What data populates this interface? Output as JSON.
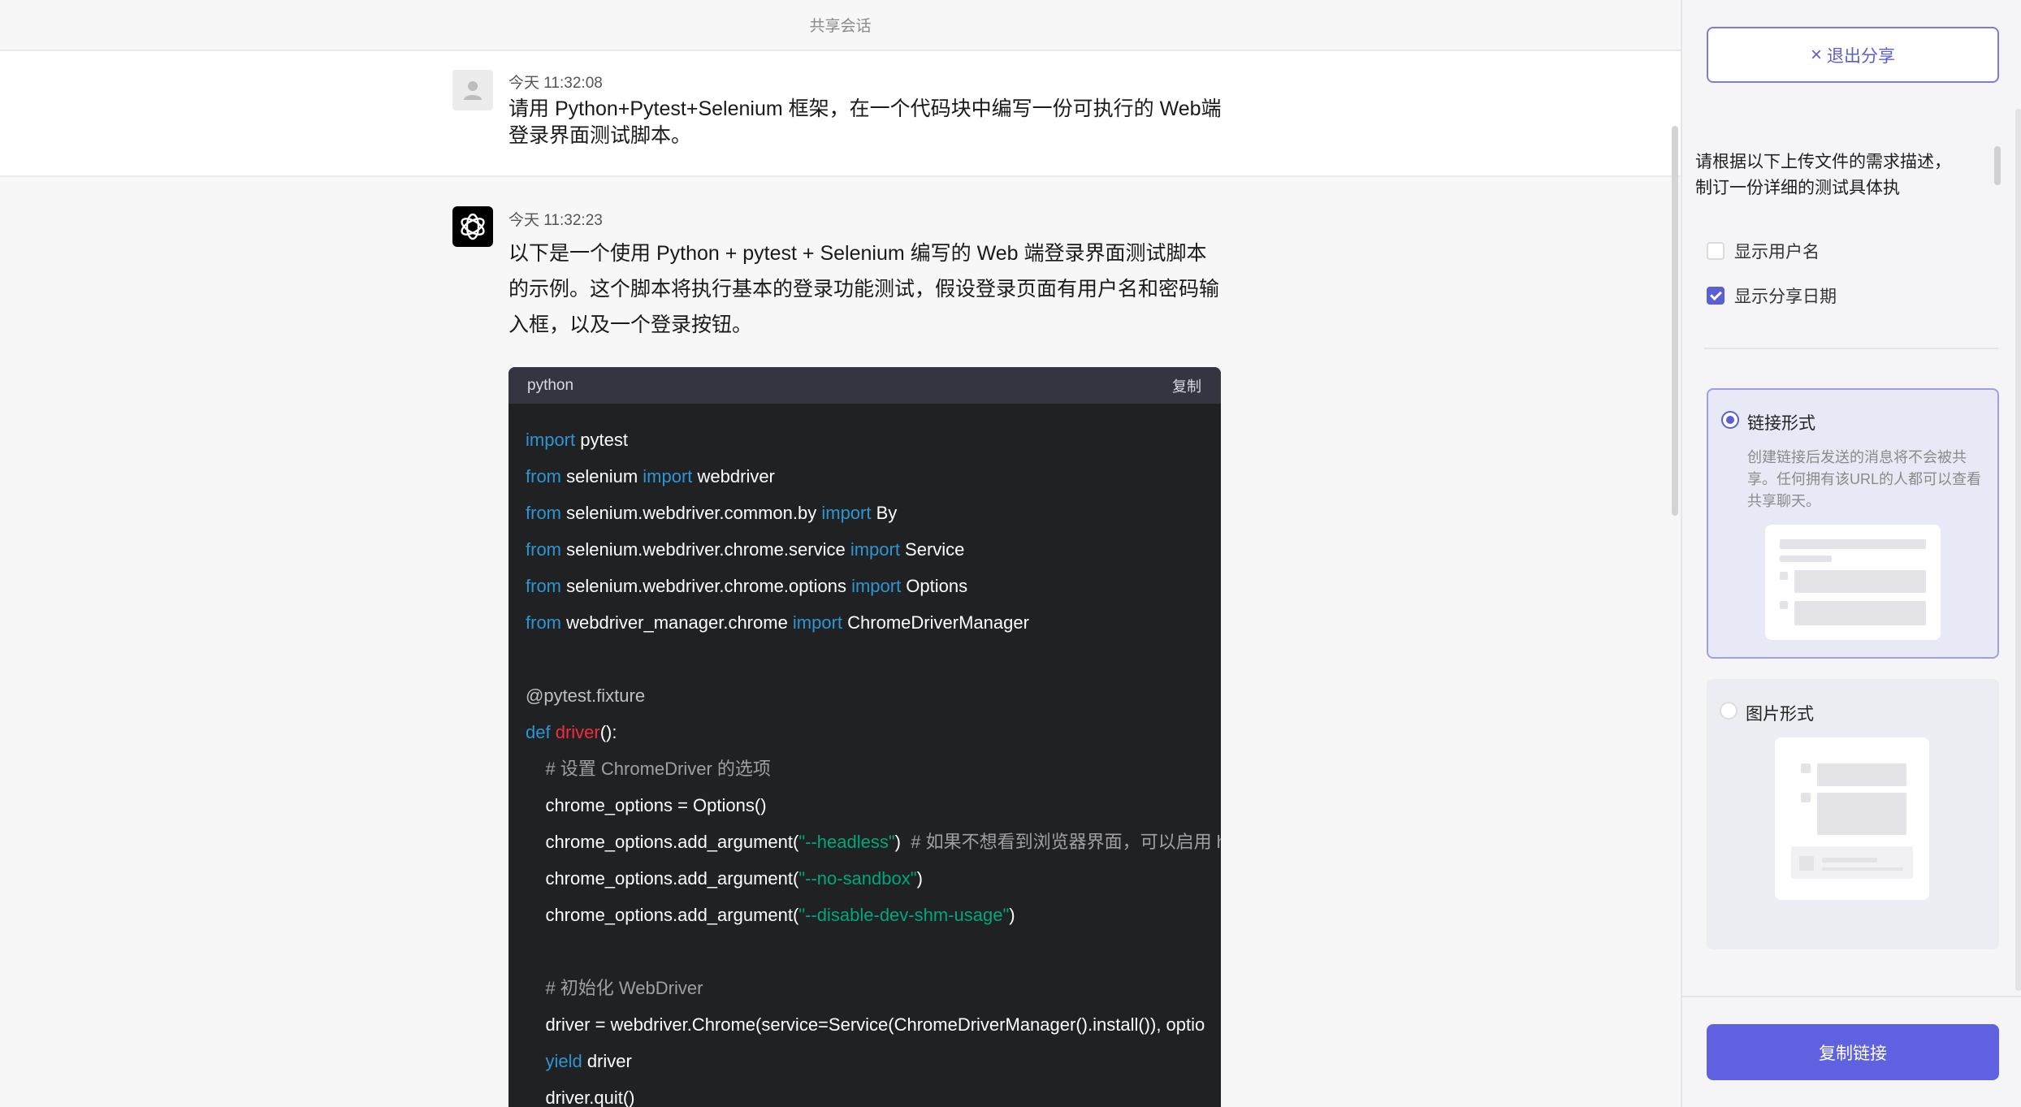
{
  "header": {
    "title": "共享会话"
  },
  "user_message": {
    "timestamp": "今天 11:32:08",
    "text": "请用 Python+Pytest+Selenium 框架，在一个代码块中编写一份可执行的 Web端登录界面测试脚本。"
  },
  "assistant_message": {
    "timestamp": "今天 11:32:23",
    "text": "以下是一个使用 Python + pytest + Selenium 编写的 Web 端登录界面测试脚本的示例。这个脚本将执行基本的登录功能测试，假设登录页面有用户名和密码输入框，以及一个登录按钮。",
    "code": {
      "language": "python",
      "copy_label": "复制",
      "lines": [
        [
          {
            "t": "import",
            "c": "kw"
          },
          {
            "t": " pytest",
            "c": ""
          }
        ],
        [
          {
            "t": "from",
            "c": "kw"
          },
          {
            "t": " selenium ",
            "c": ""
          },
          {
            "t": "import",
            "c": "kw"
          },
          {
            "t": " webdriver",
            "c": ""
          }
        ],
        [
          {
            "t": "from",
            "c": "kw"
          },
          {
            "t": " selenium.webdriver.common.by ",
            "c": ""
          },
          {
            "t": "import",
            "c": "kw"
          },
          {
            "t": " By",
            "c": ""
          }
        ],
        [
          {
            "t": "from",
            "c": "kw"
          },
          {
            "t": " selenium.webdriver.chrome.service ",
            "c": ""
          },
          {
            "t": "import",
            "c": "kw"
          },
          {
            "t": " Service",
            "c": ""
          }
        ],
        [
          {
            "t": "from",
            "c": "kw"
          },
          {
            "t": " selenium.webdriver.chrome.options ",
            "c": ""
          },
          {
            "t": "import",
            "c": "kw"
          },
          {
            "t": " Options",
            "c": ""
          }
        ],
        [
          {
            "t": "from",
            "c": "kw"
          },
          {
            "t": " webdriver_manager.chrome ",
            "c": ""
          },
          {
            "t": "import",
            "c": "kw"
          },
          {
            "t": " ChromeDriverManager",
            "c": ""
          }
        ],
        [],
        [
          {
            "t": "@pytest.fixture",
            "c": "dec"
          }
        ],
        [
          {
            "t": "def",
            "c": "kw"
          },
          {
            "t": " ",
            "c": ""
          },
          {
            "t": "driver",
            "c": "fn"
          },
          {
            "t": "():",
            "c": ""
          }
        ],
        [
          {
            "t": "    # 设置 ChromeDriver 的选项",
            "c": "cm"
          }
        ],
        [
          {
            "t": "    chrome_options = Options()",
            "c": ""
          }
        ],
        [
          {
            "t": "    chrome_options.add_argument(",
            "c": ""
          },
          {
            "t": "\"--headless\"",
            "c": "str"
          },
          {
            "t": ")  ",
            "c": ""
          },
          {
            "t": "# 如果不想看到浏览器界面，可以启用 h",
            "c": "cm"
          }
        ],
        [
          {
            "t": "    chrome_options.add_argument(",
            "c": ""
          },
          {
            "t": "\"--no-sandbox\"",
            "c": "str"
          },
          {
            "t": ")",
            "c": ""
          }
        ],
        [
          {
            "t": "    chrome_options.add_argument(",
            "c": ""
          },
          {
            "t": "\"--disable-dev-shm-usage\"",
            "c": "str"
          },
          {
            "t": ")",
            "c": ""
          }
        ],
        [],
        [
          {
            "t": "    # 初始化 WebDriver",
            "c": "cm"
          }
        ],
        [
          {
            "t": "    driver = webdriver.Chrome(service=Service(ChromeDriverManager().install()), optio",
            "c": ""
          }
        ],
        [
          {
            "t": "    ",
            "c": ""
          },
          {
            "t": "yield",
            "c": "kw"
          },
          {
            "t": " driver",
            "c": ""
          }
        ],
        [
          {
            "t": "    driver.quit()",
            "c": ""
          }
        ]
      ]
    }
  },
  "panel": {
    "exit_label": "退出分享",
    "preview_text": "请根据以下上传文件的需求描述，制订一份详细的测试具体执",
    "show_username_label": "显示用户名",
    "show_username_checked": false,
    "show_date_label": "显示分享日期",
    "show_date_checked": true,
    "link_option": {
      "title": "链接形式",
      "desc": "创建链接后发送的消息将不会被共享。任何拥有该URL的人都可以查看共享聊天。",
      "selected": true
    },
    "image_option": {
      "title": "图片形式",
      "selected": false
    },
    "copy_link_label": "复制链接"
  },
  "colors": {
    "accent": "#6061e0",
    "code_bg": "#202123",
    "keyword": "#2e95d3",
    "string": "#00a67d",
    "function": "#f22c3d"
  }
}
